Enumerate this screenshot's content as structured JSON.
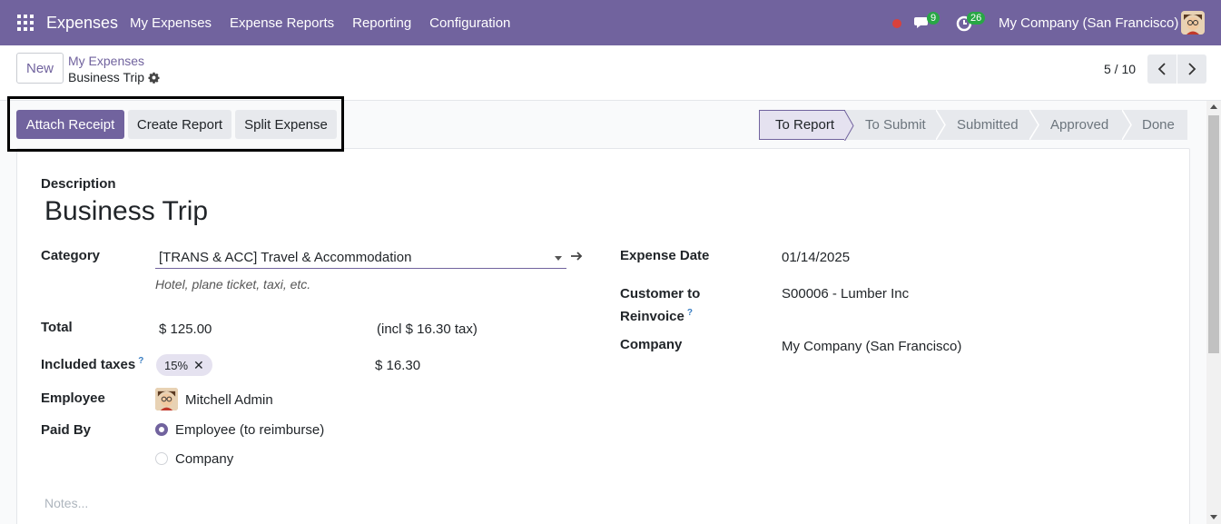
{
  "navbar": {
    "app_name": "Expenses",
    "menu": [
      "My Expenses",
      "Expense Reports",
      "Reporting",
      "Configuration"
    ],
    "chat_badge": "9",
    "activity_badge": "26",
    "company": "My Company (San Francisco)",
    "color": "#71639e"
  },
  "control_panel": {
    "new_label": "New",
    "breadcrumb_parent": "My Expenses",
    "breadcrumb_current": "Business Trip",
    "pager": "5 / 10"
  },
  "actions": {
    "attach_receipt": "Attach Receipt",
    "create_report": "Create Report",
    "split_expense": "Split Expense"
  },
  "status_stages": [
    {
      "label": "To Report",
      "active": true
    },
    {
      "label": "To Submit",
      "active": false
    },
    {
      "label": "Submitted",
      "active": false
    },
    {
      "label": "Approved",
      "active": false
    },
    {
      "label": "Done",
      "active": false
    }
  ],
  "form": {
    "description_label": "Description",
    "title": "Business Trip",
    "category_label": "Category",
    "category_value": "[TRANS & ACC] Travel & Accommodation",
    "category_help": "Hotel, plane ticket, taxi, etc.",
    "total_label": "Total",
    "total_value": "$ 125.00",
    "total_tax_note": "(incl $ 16.30 tax)",
    "taxes_label": "Included taxes",
    "taxes_help_mark": "?",
    "tax_tag": "15%",
    "tax_tag_remove": "✕",
    "tax_amount": "$ 16.30",
    "employee_label": "Employee",
    "employee_value": "Mitchell Admin",
    "paid_by_label": "Paid By",
    "paid_by_options": [
      "Employee (to reimburse)",
      "Company"
    ],
    "paid_by_selected": "Employee (to reimburse)",
    "expense_date_label": "Expense Date",
    "expense_date_value": "01/14/2025",
    "customer_label_1": "Customer to",
    "customer_label_2": "Reinvoice",
    "customer_help_mark": "?",
    "customer_value": "S00006 - Lumber Inc",
    "company_label": "Company",
    "company_value": "My Company (San Francisco)",
    "notes_placeholder": "Notes..."
  }
}
